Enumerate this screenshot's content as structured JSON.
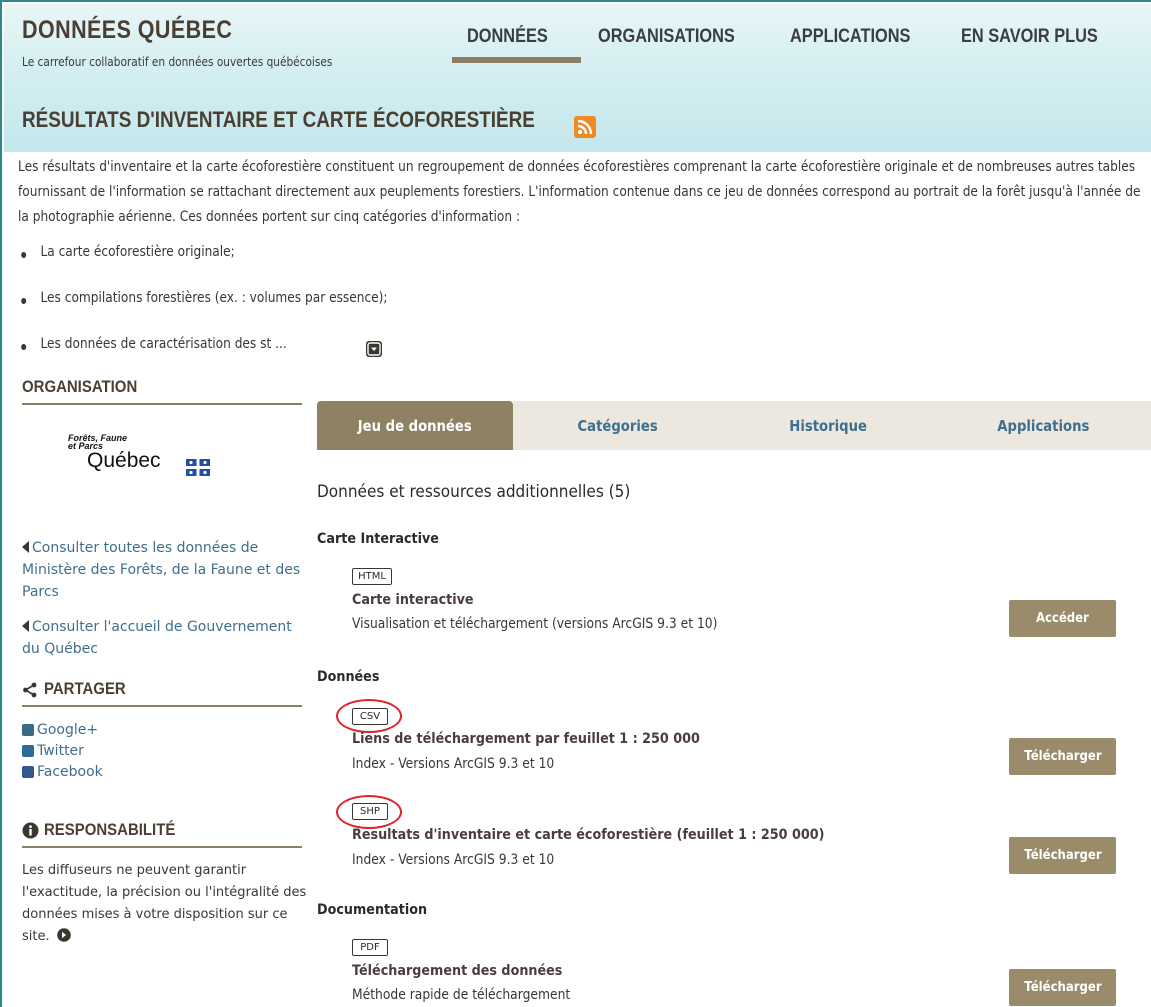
{
  "brand": {
    "title": "DONNÉES QUÉBEC",
    "tagline": "Le carrefour collaboratif en données ouvertes québécoises"
  },
  "nav": {
    "items": [
      "DONNÉES",
      "ORGANISATIONS",
      "APPLICATIONS",
      "EN SAVOIR PLUS"
    ],
    "active": "DONNÉES"
  },
  "page": {
    "title": "RÉSULTATS D'INVENTAIRE ET CARTE ÉCOFORESTIÈRE",
    "description": "Les résultats d'inventaire et la carte écoforestière constituent un regroupement de données écoforestières comprenant la carte écoforestière originale et de nombreuses autres tables fournissant de l'information se rattachant directement aux peuplements forestiers. L'information contenue dans ce jeu de données correspond au portrait de la forêt jusqu'à l'année de la photographie aérienne. Ces données portent sur cinq catégories d'information :",
    "bullets": [
      "La carte écoforestière originale;",
      "Les compilations forestières (ex. : volumes par essence);",
      "Les données de caractérisation des st ..."
    ]
  },
  "sidebar": {
    "organisation_heading": "ORGANISATION",
    "logo": {
      "line1": "Forêts, Faune",
      "line2": "et Parcs",
      "wordmark": "Québec"
    },
    "links": [
      "Consulter toutes les données de Ministère des Forêts, de la Faune et des Parcs",
      "Consulter l'accueil de Gouvernement du Québec"
    ],
    "share_heading": "PARTAGER",
    "share": [
      "Google+",
      "Twitter",
      "Facebook"
    ],
    "resp_heading": "RESPONSABILITÉ",
    "resp_text": "Les diffuseurs ne peuvent garantir l'exactitude, la précision ou l'intégralité des données mises à votre disposition sur ce site."
  },
  "tabs": [
    "Jeu de données",
    "Catégories",
    "Historique",
    "Applications"
  ],
  "resources": {
    "heading": "Données et ressources additionnelles (5)",
    "sections": [
      {
        "title": "Carte Interactive",
        "items": [
          {
            "format": "HTML",
            "name": "Carte interactive",
            "desc": "Visualisation et téléchargement (versions ArcGIS 9.3 et 10)",
            "action": "Accéder"
          }
        ]
      },
      {
        "title": "Données",
        "items": [
          {
            "format": "CSV",
            "name": "Liens de téléchargement par feuillet 1 : 250 000",
            "desc": "Index - Versions ArcGIS 9.3 et 10",
            "action": "Télécharger"
          },
          {
            "format": "SHP",
            "name": "Resultats d'inventaire et carte écoforestière (feuillet 1 : 250 000)",
            "desc": "Index - Versions ArcGIS 9.3 et 10",
            "action": "Télécharger"
          }
        ]
      },
      {
        "title": "Documentation",
        "items": [
          {
            "format": "PDF",
            "name": "Téléchargement des données",
            "desc": "Méthode rapide de téléchargement",
            "action": "Télécharger"
          }
        ]
      }
    ]
  },
  "colors": {
    "brand_brown": "#4a3f32",
    "accent_tan": "#8f8263",
    "link_blue": "#3f6f8c",
    "header_teal": "#c4e7ec",
    "rss_orange": "#f08a24",
    "annotation_red": "#e0212a"
  },
  "icons": {
    "rss": "rss-icon",
    "expand": "expand-down-icon",
    "share": "share-icon",
    "google": "google-plus-icon",
    "twitter": "twitter-icon",
    "facebook": "facebook-icon",
    "info": "info-icon",
    "arrow": "arrow-right-circle-icon"
  }
}
